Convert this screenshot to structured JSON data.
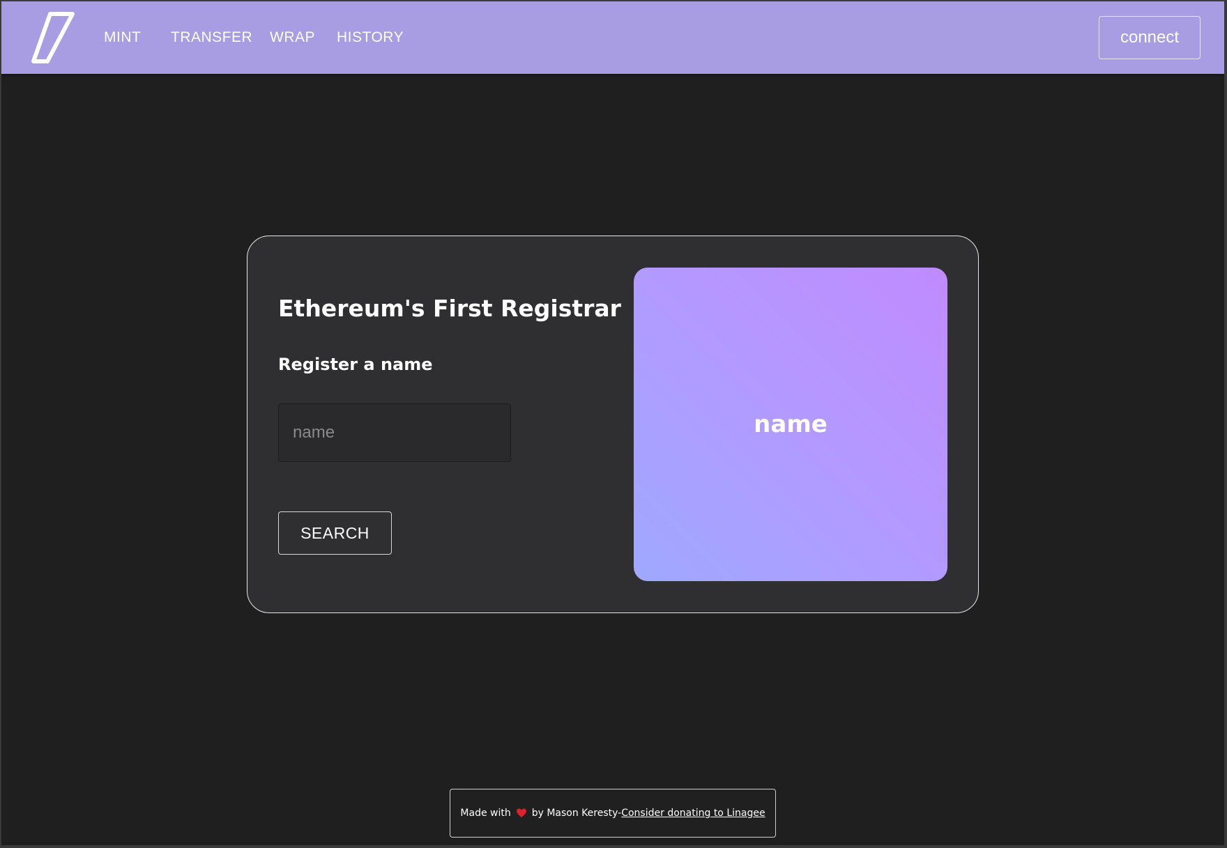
{
  "nav": {
    "links": [
      "MINT",
      "TRANSFER",
      "WRAP",
      "HISTORY"
    ],
    "connect_label": "connect"
  },
  "card": {
    "title": "Ethereum's First Registrar",
    "subtitle": "Register a name",
    "input_placeholder": "name",
    "input_value": "",
    "search_label": "SEARCH",
    "preview_text": "name"
  },
  "footer": {
    "made_with": "Made with",
    "by_text": "by Mason Keresty-",
    "link_text": "Consider donating to Linagee"
  },
  "colors": {
    "navbar": "#a89de2",
    "background": "#1f1f1f",
    "card": "#2f2f31",
    "heart": "#e0202a"
  },
  "icons": {
    "logo": "linagee-logo-icon",
    "heart": "heart-icon"
  }
}
